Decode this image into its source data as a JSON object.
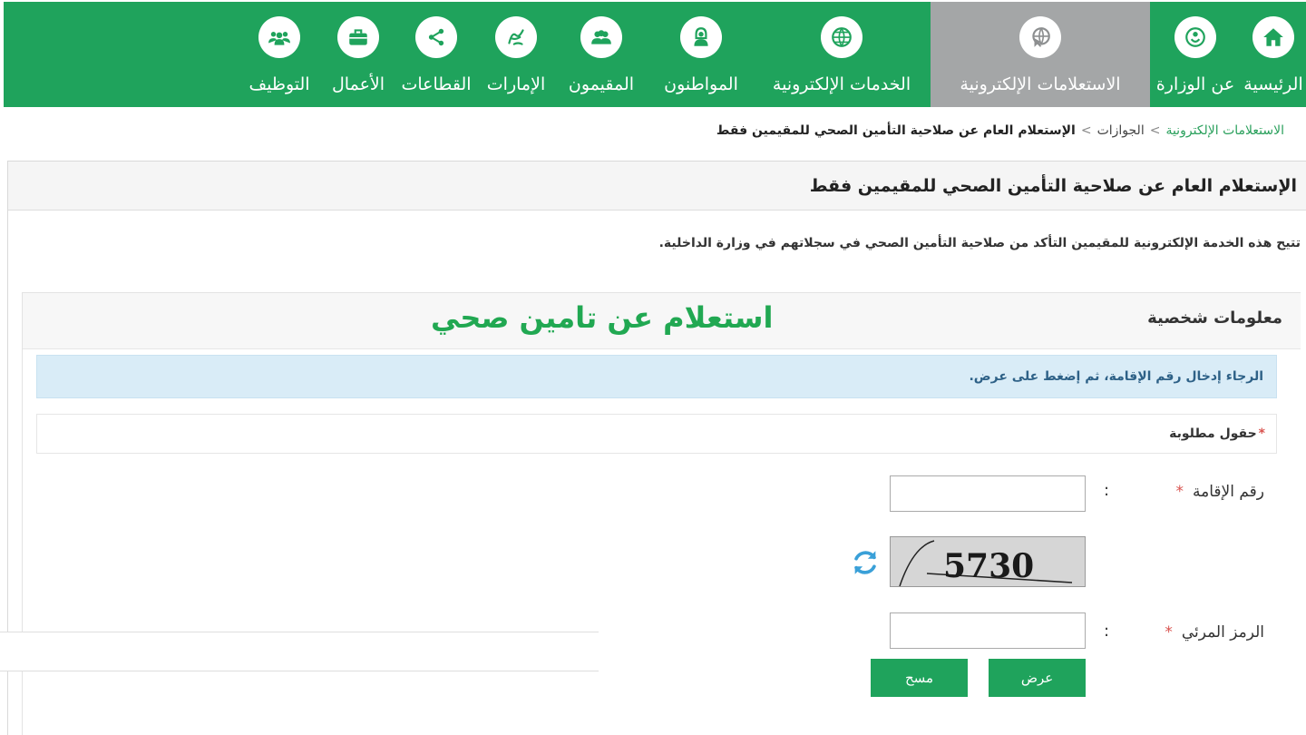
{
  "nav": {
    "items": [
      {
        "label": "الرئيسية",
        "icon": "home-icon"
      },
      {
        "label": "عن الوزارة",
        "icon": "ministry-emblem-icon"
      },
      {
        "label": "الاستعلامات الإلكترونية",
        "icon": "globe-pointer-icon",
        "active": true
      },
      {
        "label": "الخدمات الإلكترونية",
        "icon": "globe-icon"
      },
      {
        "label": "المواطنون",
        "icon": "citizen-icon"
      },
      {
        "label": "المقيمون",
        "icon": "residents-icon"
      },
      {
        "label": "الإمارات",
        "icon": "emirates-calligraphy-icon"
      },
      {
        "label": "القطاعات",
        "icon": "sectors-network-icon"
      },
      {
        "label": "الأعمال",
        "icon": "briefcase-icon"
      },
      {
        "label": "التوظيف",
        "icon": "employment-group-icon"
      }
    ]
  },
  "breadcrumb": {
    "root": "الاستعلامات الإلكترونية",
    "middle": "الجوازات",
    "current": "الإستعلام العام عن صلاحية التأمين الصحي للمقيمين فقط",
    "separator": ">"
  },
  "panel": {
    "title": "الإستعلام العام عن صلاحية التأمين الصحي للمقيمين فقط",
    "intro": "تتيح هذه الخدمة الإلكترونية للمقيمين التأكد من صلاحية التأمين الصحي في سجلاتهم في وزارة الداخلية."
  },
  "form": {
    "section_title": "معلومات شخصية",
    "overlay_caption": "استعلام عن تامين صحي",
    "alert": "الرجاء إدخال رقم الإقامة، ثم إضغط على عرض.",
    "required_note": "حقول مطلوبة",
    "required_star": "*",
    "iqama_label": "رقم الإقامة",
    "iqama_value": "",
    "captcha_text": "5730",
    "captcha_code_label": "الرمز المرئي",
    "captcha_code_value": "",
    "colon": ":",
    "submit_label": "عرض",
    "clear_label": "مسح"
  },
  "colors": {
    "brand_green": "#1fa35c",
    "active_tab": "#a4a6a7",
    "alert_bg": "#d9ecf7",
    "required_red": "#d9534f"
  }
}
